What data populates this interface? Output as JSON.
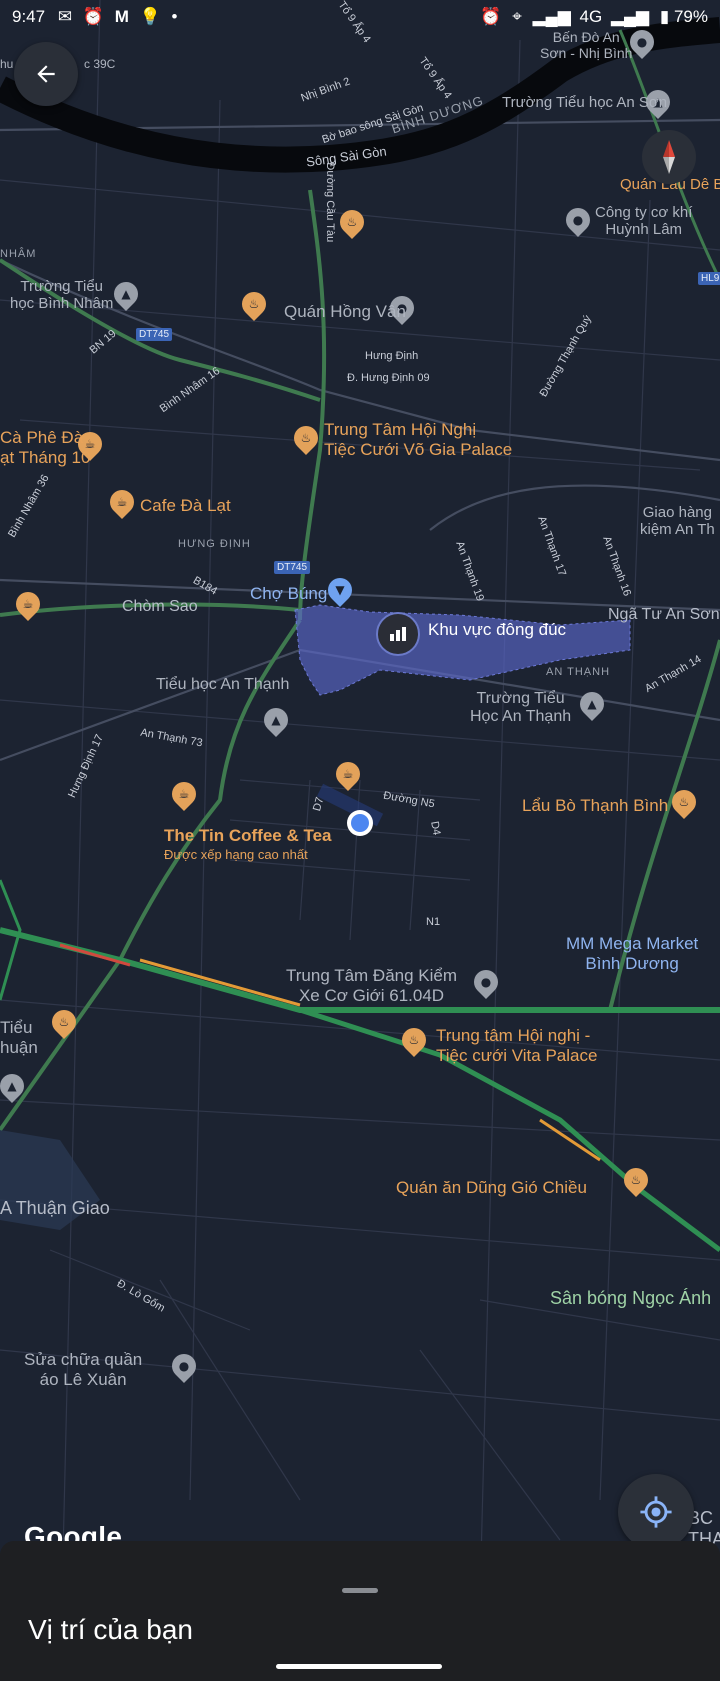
{
  "status_bar": {
    "time": "9:47",
    "left_icons": [
      "chat-icon",
      "alarm-icon",
      "gmail-icon",
      "bulb-icon",
      "dot-icon"
    ],
    "network": "4G",
    "battery": "79%"
  },
  "colors": {
    "map_bg": "#1c2331",
    "road": "#3a4150",
    "major_road": "#4c5466",
    "river": "#07090d",
    "traffic_green": "#2f8f53",
    "traffic_orange": "#e39a37",
    "traffic_red": "#d04a3e",
    "crowd_area": "#5b67c9",
    "poi_orange": "#e3a25a"
  },
  "map": {
    "roads": [
      {
        "text": "Tổ 9 Ấp 4"
      },
      {
        "text": "Tổ 9 Ấp 4"
      },
      {
        "text": "Nhị Bình 2"
      },
      {
        "text": "Bờ bao sông Sài Gòn"
      },
      {
        "text": "Sông Sài Gòn"
      },
      {
        "text": "Đường Cầu Tàu"
      },
      {
        "text": "Hưng Định"
      },
      {
        "text": "Đ. Hưng Định 09"
      },
      {
        "text": "Đường Thạnh Quý"
      },
      {
        "text": "BN 19"
      },
      {
        "text": "Bình Nhâm 16"
      },
      {
        "text": "Bình Nhâm 36"
      },
      {
        "text": "B184"
      },
      {
        "text": "An Thạnh 19"
      },
      {
        "text": "An Thạnh 17"
      },
      {
        "text": "An Thạnh 16"
      },
      {
        "text": "An Thạnh 14"
      },
      {
        "text": "An Thạnh 73"
      },
      {
        "text": "Hưng Định 17"
      },
      {
        "text": "D7"
      },
      {
        "text": "Đường N5"
      },
      {
        "text": "D4"
      },
      {
        "text": "N1"
      },
      {
        "text": "Đ. Lò Gốm"
      }
    ],
    "areas": [
      {
        "text": "BÌNH DƯƠNG"
      },
      {
        "text": "NHÂM"
      },
      {
        "text": "HƯNG ĐỊNH"
      },
      {
        "text": "AN THẠNH"
      }
    ],
    "shields": [
      "DT745",
      "DT745",
      "HL9"
    ],
    "places": [
      {
        "text": "Bến Đò An\nSơn - Nhị Bình"
      },
      {
        "text": "Trường Tiểu học An Sơn"
      },
      {
        "text": "Quán Lẩu Dê Ba"
      },
      {
        "text": "Công ty cơ khí\nHuỳnh Lâm"
      },
      {
        "text": "Trường Tiểu\nhọc Bình Nhâm"
      },
      {
        "text": "Quán Hồng Vân"
      },
      {
        "text": "Trung Tâm Hội Nghị\nTiệc Cưới Võ Gia Palace"
      },
      {
        "text": "Cà Phê Đà\nạt Tháng 10"
      },
      {
        "text": "Cafe Đà Lạt"
      },
      {
        "text": "Giao hàng\nkiệm An Th"
      },
      {
        "text": "Chợ Búng"
      },
      {
        "text": "Chòm Sao"
      },
      {
        "text": "Khu vực đông đúc"
      },
      {
        "text": "Ngã Tư An Sơn"
      },
      {
        "text": "Tiểu học An Thạnh"
      },
      {
        "text": "Trường Tiểu\nHọc An Thạnh"
      },
      {
        "text": "The Tin Coffee & Tea"
      },
      {
        "text": "Được xếp hạng cao nhất"
      },
      {
        "text": "Lẩu Bò Thạnh Bình"
      },
      {
        "text": "MM Mega Market\nBình Dương"
      },
      {
        "text": "Trung Tâm Đăng Kiểm\nXe Cơ Giới 61.04D"
      },
      {
        "text": "Tiểu\nhuận"
      },
      {
        "text": "Trung tâm Hội nghị -\nTiệc cưới Vita Palace"
      },
      {
        "text": "A Thuận Giao"
      },
      {
        "text": "Quán ăn Dũng Gió Chiều"
      },
      {
        "text": "Sân bóng Ngọc Ánh"
      },
      {
        "text": "Sửa chữa quần\náo Lê Xuân"
      },
      {
        "text": "BC\nTHAN"
      },
      {
        "text": "hu"
      },
      {
        "text": "c 39C"
      },
      {
        "text": "3"
      }
    ]
  },
  "controls": {
    "back_icon": "arrow-left-icon",
    "compass_icon": "compass-icon",
    "my_location_icon": "my-location-icon"
  },
  "branding": {
    "logo": "Google"
  },
  "bottom_sheet": {
    "title": "Vị trí của bạn"
  }
}
